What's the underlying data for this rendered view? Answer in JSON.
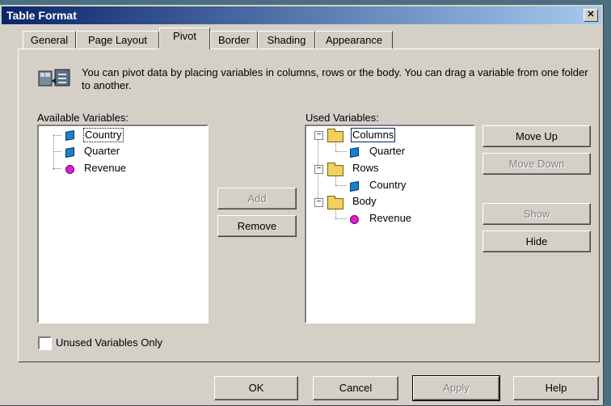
{
  "window": {
    "title": "Table Format",
    "close_icon": "close-icon"
  },
  "tabs": [
    {
      "label": "General"
    },
    {
      "label": "Page Layout"
    },
    {
      "label": "Pivot",
      "selected": true
    },
    {
      "label": "Border"
    },
    {
      "label": "Shading"
    },
    {
      "label": "Appearance"
    }
  ],
  "info": {
    "text": "You can pivot data by placing variables in columns, rows or the body. You can drag a variable from one folder to another.",
    "icon": "pivot-icon"
  },
  "available": {
    "label": "Available Variables:",
    "items": [
      {
        "label": "Country",
        "icon": "cube-icon",
        "focused": true
      },
      {
        "label": "Quarter",
        "icon": "cube-icon"
      },
      {
        "label": "Revenue",
        "icon": "dot-icon"
      }
    ]
  },
  "used": {
    "label": "Used Variables:",
    "folders": [
      {
        "label": "Columns",
        "child": "Quarter",
        "child_icon": "cube-icon",
        "focused": true
      },
      {
        "label": "Rows",
        "child": "Country",
        "child_icon": "cube-icon"
      },
      {
        "label": "Body",
        "child": "Revenue",
        "child_icon": "dot-icon"
      }
    ]
  },
  "buttons": {
    "add": "Add",
    "remove": "Remove",
    "move_up": "Move Up",
    "move_down": "Move Down",
    "show": "Show",
    "hide": "Hide",
    "ok": "OK",
    "cancel": "Cancel",
    "apply": "Apply",
    "help": "Help"
  },
  "checkbox": {
    "label": "Unused Variables Only",
    "checked": false
  },
  "colors": {
    "title_start": "#0a246a",
    "title_end": "#a6caf0",
    "face": "#d4d0c8",
    "disabled": "#808080"
  }
}
